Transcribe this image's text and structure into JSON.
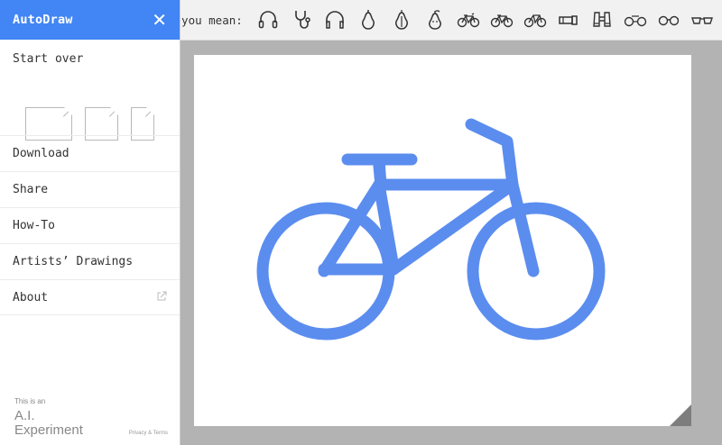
{
  "header": {
    "title": "AutoDraw",
    "close_icon": "close-icon"
  },
  "sidebar": {
    "start_over": "Start over",
    "menu": [
      {
        "label": "Download"
      },
      {
        "label": "Share"
      },
      {
        "label": "How-To"
      },
      {
        "label": "Artists’ Drawings"
      },
      {
        "label": "About",
        "icon": "external-link-icon"
      }
    ],
    "footer": {
      "this_is": "This is an",
      "ai": "A.I.",
      "experiment": "Experiment",
      "legal": "Privacy & Terms"
    }
  },
  "suggestions": {
    "label": "o you mean:",
    "items": [
      "headphones-icon",
      "stethoscope-icon",
      "headphones-icon",
      "pear-icon",
      "pear-icon",
      "pear-icon",
      "bicycle-icon",
      "bicycle-icon",
      "bicycle-icon",
      "flashlight-icon",
      "binoculars-icon",
      "bicycle-icon",
      "glasses-icon",
      "glasses-icon"
    ]
  },
  "colors": {
    "accent": "#4285f4",
    "bike": "#5b8def"
  }
}
